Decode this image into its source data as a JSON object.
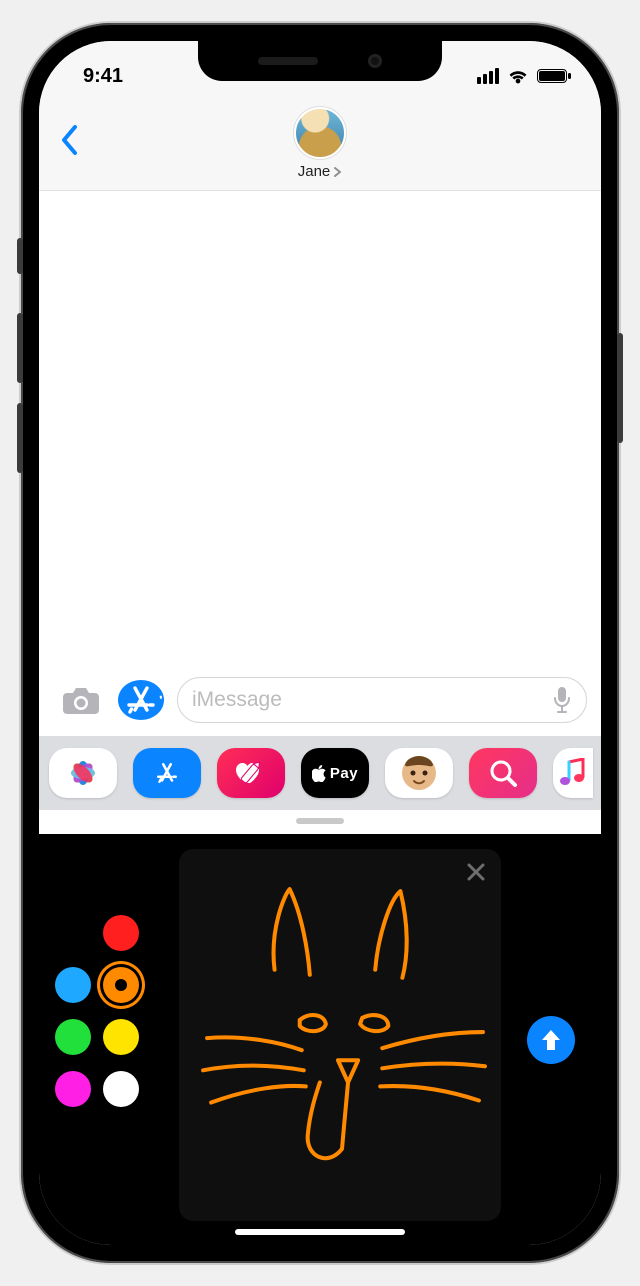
{
  "status_bar": {
    "time": "9:41"
  },
  "contact": {
    "name": "Jane"
  },
  "compose": {
    "placeholder": "iMessage"
  },
  "app_strip": {
    "apple_pay_label": "Pay",
    "items": [
      "photos",
      "app-store",
      "digital-touch",
      "apple-pay",
      "memoji",
      "images",
      "music"
    ]
  },
  "digital_touch": {
    "colors": [
      {
        "name": "red",
        "hex": "#ff1f1f",
        "selected": false
      },
      {
        "name": "blue",
        "hex": "#1fa8ff",
        "selected": false
      },
      {
        "name": "orange",
        "hex": "#ff8a00",
        "selected": true
      },
      {
        "name": "green",
        "hex": "#22e03c",
        "selected": false
      },
      {
        "name": "yellow",
        "hex": "#ffe400",
        "selected": false
      },
      {
        "name": "magenta",
        "hex": "#ff1fe5",
        "selected": false
      },
      {
        "name": "white",
        "hex": "#ffffff",
        "selected": false
      }
    ],
    "drawing_subject": "cat-face",
    "stroke_color": "#ff8a00"
  },
  "colors": {
    "accent": "#0a84ff",
    "header_bg": "#f7f7f7",
    "app_strip_bg": "#dbdde0"
  }
}
